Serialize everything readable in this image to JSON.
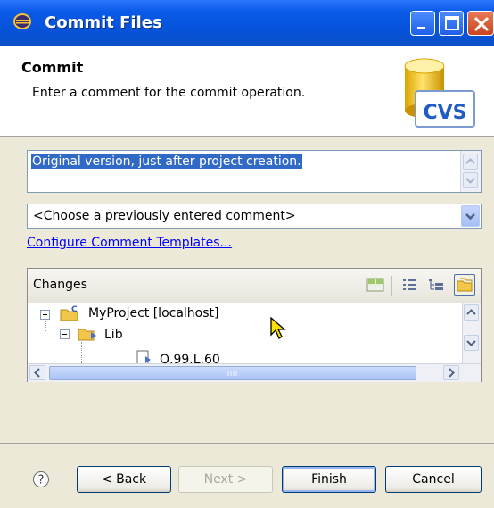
{
  "window": {
    "title": "Commit Files",
    "app_icon": "eclipse-icon",
    "controls": [
      "minimize-icon",
      "maximize-icon",
      "close-icon"
    ]
  },
  "header": {
    "title": "Commit",
    "description": "Enter a comment for the commit operation.",
    "logo_text": "CVS"
  },
  "comment": {
    "value": "Original version, just after project creation."
  },
  "previous_comments": {
    "selected": "<Choose a previously entered comment>"
  },
  "templates_link": "Configure Comment Templates...",
  "changes": {
    "label": "Changes",
    "toolbar_icons": [
      "show-compare-icon",
      "flat-mode-icon",
      "tree-mode-icon",
      "compressed-folders-icon"
    ],
    "tree": [
      {
        "label": "MyProject  [localhost]",
        "depth": 0,
        "icon": "project-icon",
        "expanded": true
      },
      {
        "label": "Lib",
        "depth": 1,
        "icon": "folder-icon",
        "expanded": true
      },
      {
        "label": "Q.99.L.60",
        "depth": 2,
        "icon": "file-icon",
        "expanded": false
      }
    ]
  },
  "buttons": {
    "back": "< Back",
    "next": "Next >",
    "finish": "Finish",
    "cancel": "Cancel"
  },
  "colors": {
    "titlebar": "#0a5ae8",
    "selection": "#3169c6",
    "link": "#0000ff",
    "dialog_bg": "#ece9d8"
  }
}
